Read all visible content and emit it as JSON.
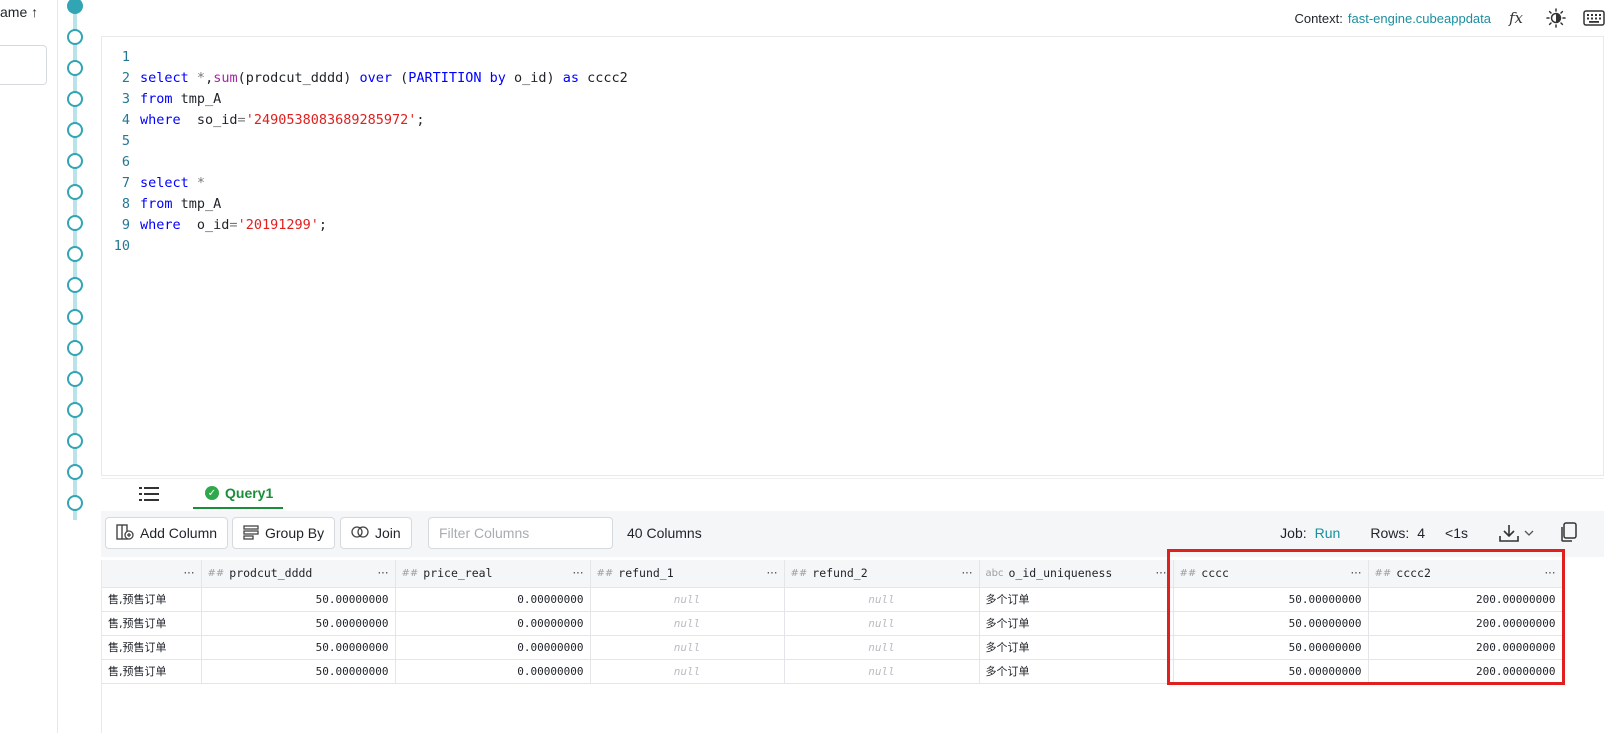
{
  "left_pane": {
    "sort_label": "ame ↑"
  },
  "header": {
    "context_label": "Context:",
    "context_value": "fast-engine.cubeappdata",
    "icons": [
      "fx-icon",
      "theme-toggle-icon",
      "keyboard-icon"
    ]
  },
  "editor": {
    "lines": [
      {
        "n": "1",
        "code": ""
      },
      {
        "n": "2",
        "code": "select *,sum(prodcut_dddd) over (PARTITION by o_id) as cccc2"
      },
      {
        "n": "3",
        "code": "from tmp_A"
      },
      {
        "n": "4",
        "code": "where  so_id='2490538083689285972';"
      },
      {
        "n": "5",
        "code": ""
      },
      {
        "n": "6",
        "code": ""
      },
      {
        "n": "7",
        "code": "select *"
      },
      {
        "n": "8",
        "code": "from tmp_A"
      },
      {
        "n": "9",
        "code": "where  o_id='20191299';"
      },
      {
        "n": "10",
        "code": ""
      }
    ]
  },
  "tabs": {
    "query1_label": "Query1"
  },
  "toolbar": {
    "add_column": "Add Column",
    "group_by": "Group By",
    "join": "Join",
    "filter_placeholder": "Filter Columns",
    "column_count": "40 Columns",
    "job_label": "Job:",
    "job_value": "Run",
    "rows_label": "Rows:",
    "rows_value": "4",
    "duration": "<1s"
  },
  "table": {
    "columns": [
      {
        "name": "",
        "type": ""
      },
      {
        "name": "prodcut_dddd",
        "type": "##"
      },
      {
        "name": "price_real",
        "type": "##"
      },
      {
        "name": "refund_1",
        "type": "##"
      },
      {
        "name": "refund_2",
        "type": "##"
      },
      {
        "name": "o_id_uniqueness",
        "type": "abc"
      },
      {
        "name": "cccc",
        "type": "##"
      },
      {
        "name": "cccc2",
        "type": "##"
      }
    ],
    "rows": [
      [
        "售,预售订单",
        "50.00000000",
        "0.00000000",
        "null",
        "null",
        "多个订单",
        "50.00000000",
        "200.00000000"
      ],
      [
        "售,预售订单",
        "50.00000000",
        "0.00000000",
        "null",
        "null",
        "多个订单",
        "50.00000000",
        "200.00000000"
      ],
      [
        "售,预售订单",
        "50.00000000",
        "0.00000000",
        "null",
        "null",
        "多个订单",
        "50.00000000",
        "200.00000000"
      ],
      [
        "售,预售订单",
        "50.00000000",
        "0.00000000",
        "null",
        "null",
        "多个订单",
        "50.00000000",
        "200.00000000"
      ]
    ]
  },
  "colors": {
    "accent": "#1a8fa0",
    "success": "#2ea84a",
    "highlight": "#e0201f"
  }
}
